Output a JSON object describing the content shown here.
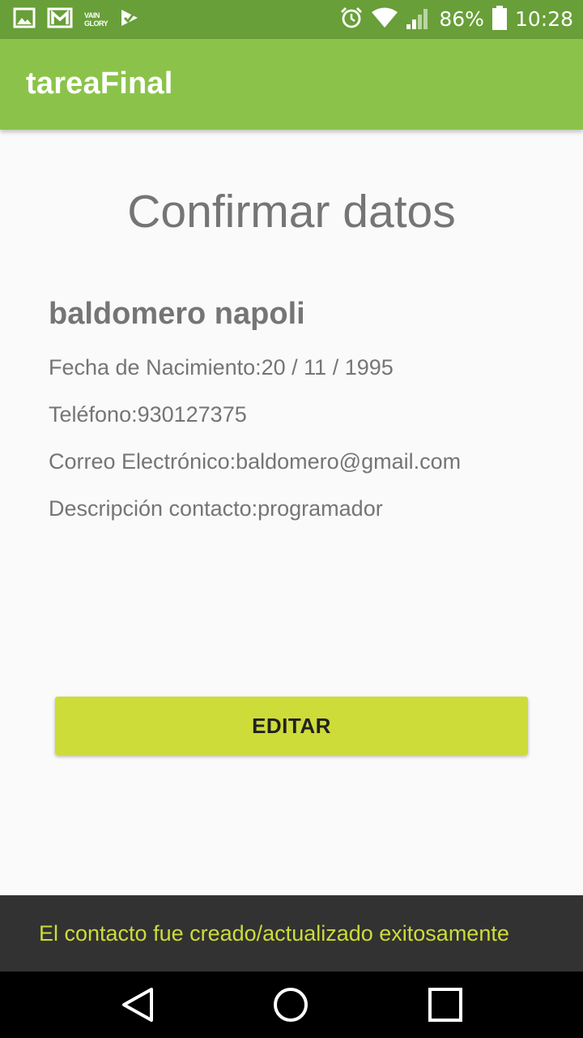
{
  "status_bar": {
    "left_icons": [
      "gallery-icon",
      "gmail-icon",
      "vainglory-icon",
      "play-games-icon"
    ],
    "vainglory_line1": "VAIN",
    "vainglory_line2": "GLORY",
    "right_icons": [
      "alarm-icon",
      "wifi-icon",
      "signal-icon",
      "battery-icon"
    ],
    "battery_percent": "86%",
    "time": "10:28"
  },
  "app_bar": {
    "title": "tareaFinal"
  },
  "main": {
    "title": "Confirmar datos",
    "contact_name": "baldomero napoli",
    "rows": [
      "Fecha de Nacimiento:20 / 11 / 1995",
      "Teléfono:930127375",
      "Correo Electrónico:baldomero@gmail.com",
      "Descripción contacto:programador"
    ],
    "edit_button_label": "EDITAR"
  },
  "snackbar": {
    "message": "El contacto fue creado/actualizado exitosamente"
  },
  "nav_bar": {
    "buttons": [
      "back-icon",
      "home-icon",
      "recents-icon"
    ]
  },
  "colors": {
    "status_bar": "#689f38",
    "app_bar": "#8bc34a",
    "button": "#cddc39",
    "snackbar_bg": "#323232",
    "snackbar_text": "#cddc39",
    "text": "#757575"
  }
}
